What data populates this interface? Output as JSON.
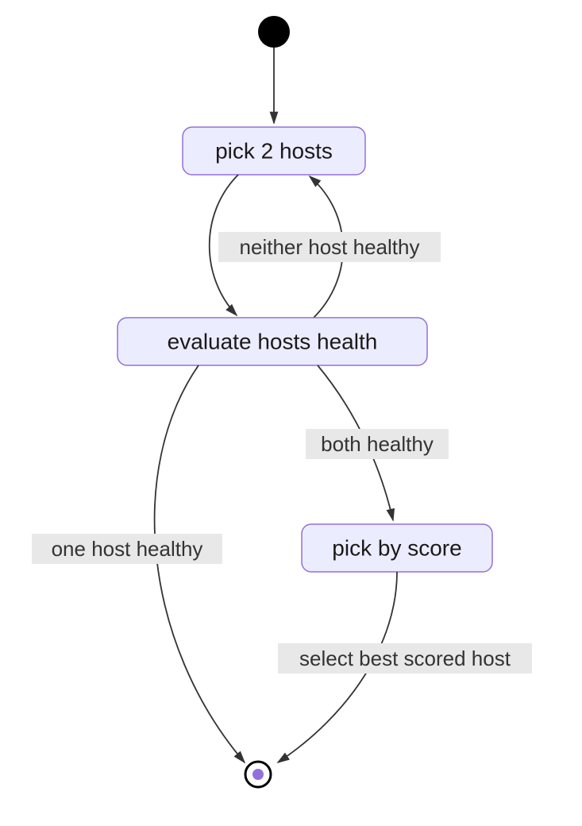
{
  "diagram": {
    "type": "state-diagram",
    "states": {
      "pick2": "pick 2 hosts",
      "evaluate": "evaluate hosts health",
      "pickscore": "pick by score"
    },
    "edges": {
      "neither": "neither host healthy",
      "both": "both healthy",
      "one": "one host healthy",
      "selectbest": "select best scored host"
    }
  }
}
